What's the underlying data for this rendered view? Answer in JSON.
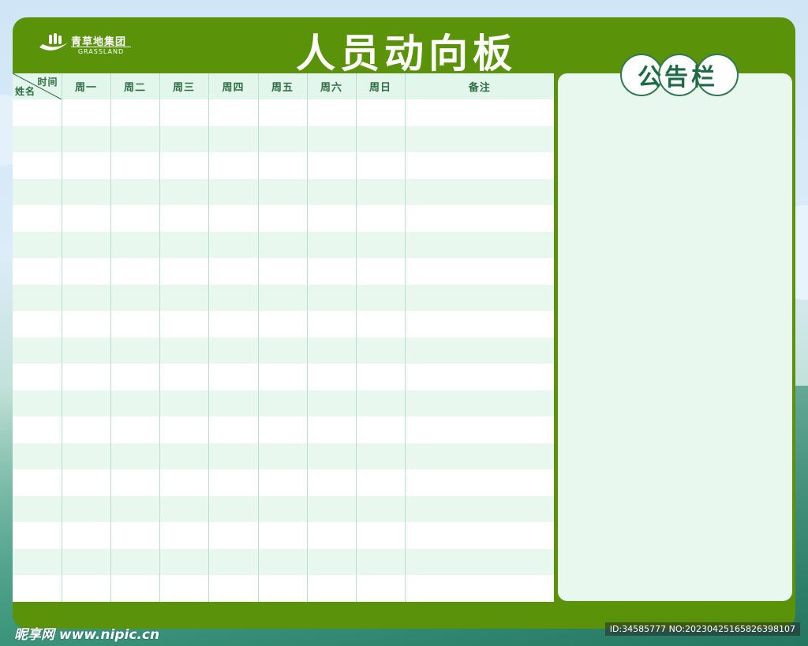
{
  "header": {
    "title": "人员动向板",
    "logo": {
      "name_cn": "青草地集团",
      "name_en": "GRASSLAND"
    }
  },
  "table": {
    "corner_top": "时间",
    "corner_bottom": "姓名",
    "columns": [
      "周一",
      "周二",
      "周三",
      "周四",
      "周五",
      "周六",
      "周日",
      "备注"
    ],
    "row_count": 19
  },
  "notice": {
    "title": "公告栏"
  },
  "footer": {
    "watermark": "昵享网 www.nipic.cn",
    "id_text": "ID:34585777 NO:20230425165826398107"
  },
  "colors": {
    "board_green": "#5a9309",
    "header_row": "#e3f6ec",
    "stripe": "#e8f8ef",
    "text_green": "#2f6e43"
  }
}
